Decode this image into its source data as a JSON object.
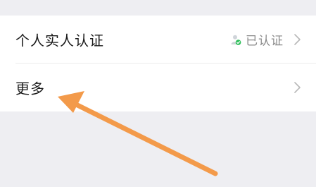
{
  "settings_list": {
    "items": [
      {
        "label": "个人实人认证",
        "status": "已认证",
        "status_icon": "verified-person-icon",
        "chevron_icon": "chevron-right-icon"
      },
      {
        "label": "更多",
        "chevron_icon": "chevron-right-icon"
      }
    ]
  },
  "annotation": {
    "arrow_icon": "pointer-arrow-icon",
    "arrow_color": "#f39a4a"
  },
  "colors": {
    "background": "#eeeef2",
    "card": "#ffffff",
    "verified_green": "#2fbf5b",
    "muted_text": "#8a8a8a",
    "divider": "#ececec"
  }
}
